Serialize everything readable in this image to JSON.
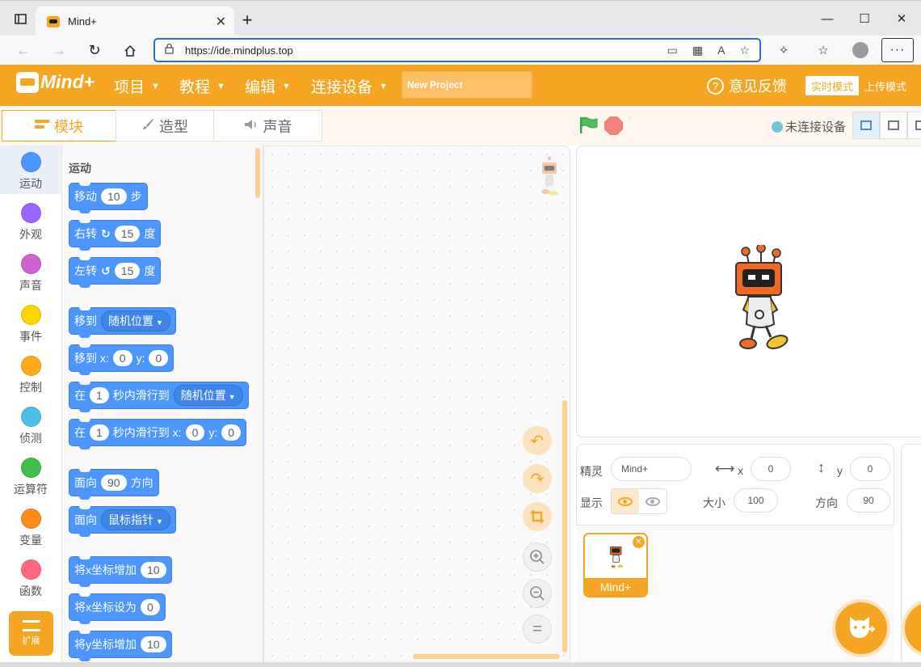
{
  "browser": {
    "tab_title": "Mind+",
    "tab_close": "✕",
    "new_tab": "+",
    "url": "https://ide.mindplus.top",
    "win_controls": {
      "minimize": "—",
      "maximize": "☐",
      "close": "✕"
    },
    "more": "···"
  },
  "app": {
    "logo_text": "Mind+",
    "menus": [
      {
        "label": "项目"
      },
      {
        "label": "教程"
      },
      {
        "label": "编辑"
      },
      {
        "label": "连接设备"
      }
    ],
    "project_name": "New Project",
    "feedback": "意见反馈",
    "mode_realtime": "实时模式",
    "mode_upload": "上传模式",
    "accent_color": "#f6a522"
  },
  "editor_tabs": [
    {
      "label": "模块",
      "icon": "blocks-icon"
    },
    {
      "label": "造型",
      "icon": "brush-icon"
    },
    {
      "label": "声音",
      "icon": "speaker-icon"
    }
  ],
  "device_status": "未连接设备",
  "categories": [
    {
      "label": "运动",
      "color": "#4c97ff"
    },
    {
      "label": "外观",
      "color": "#9966ff"
    },
    {
      "label": "声音",
      "color": "#cf63cf"
    },
    {
      "label": "事件",
      "color": "#ffd500"
    },
    {
      "label": "控制",
      "color": "#ffab19"
    },
    {
      "label": "侦测",
      "color": "#4cbfe6"
    },
    {
      "label": "运算符",
      "color": "#40bf4a"
    },
    {
      "label": "变量",
      "color": "#ff8c1a"
    },
    {
      "label": "函数",
      "color": "#ff6680"
    }
  ],
  "extension_label": "扩展",
  "palette": {
    "section_title": "运动",
    "blocks": {
      "move": {
        "a": "移动",
        "v": "10",
        "b": "步"
      },
      "turn_right": {
        "a": "右转",
        "v": "15",
        "b": "度"
      },
      "turn_left": {
        "a": "左转",
        "v": "15",
        "b": "度"
      },
      "goto": {
        "a": "移到",
        "dd": "随机位置"
      },
      "goto_xy": {
        "a": "移到 x:",
        "x": "0",
        "b": "y:",
        "y": "0"
      },
      "glide": {
        "a": "在",
        "v": "1",
        "b": "秒内滑行到",
        "dd": "随机位置"
      },
      "glide_xy": {
        "a": "在",
        "v": "1",
        "b": "秒内滑行到 x:",
        "x": "0",
        "c": "y:",
        "y": "0"
      },
      "point_dir": {
        "a": "面向",
        "v": "90",
        "b": "方向"
      },
      "point_towards": {
        "a": "面向",
        "dd": "鼠标指针"
      },
      "change_x": {
        "a": "将x坐标增加",
        "v": "10"
      },
      "set_x": {
        "a": "将x坐标设为",
        "v": "0"
      },
      "change_y": {
        "a": "将y坐标增加",
        "v": "10"
      }
    }
  },
  "sprite_info": {
    "sprite_label": "精灵",
    "sprite_name": "Mind+",
    "x_label": "x",
    "x_value": "0",
    "y_label": "y",
    "y_value": "0",
    "show_label": "显示",
    "size_label": "大小",
    "size_value": "100",
    "direction_label": "方向",
    "direction_value": "90"
  },
  "sprites": [
    {
      "name": "Mind+"
    }
  ]
}
